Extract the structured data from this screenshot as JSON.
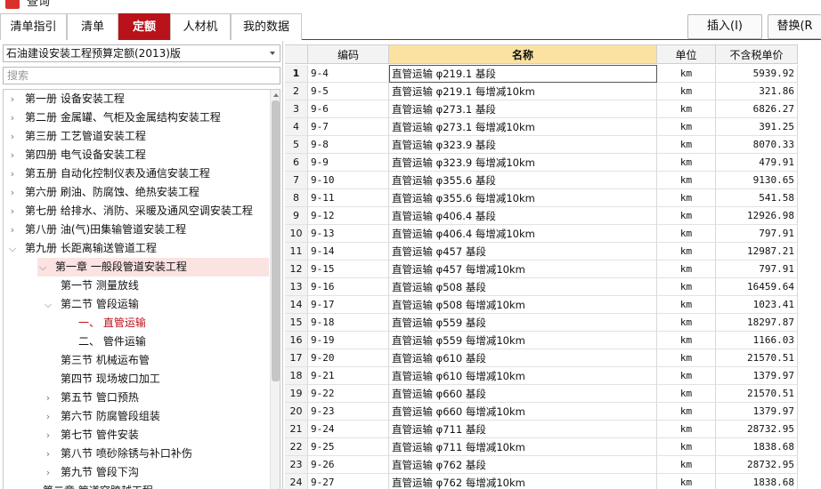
{
  "window": {
    "title": "查询"
  },
  "tabs": [
    {
      "label": "清单指引",
      "active": false
    },
    {
      "label": "清单",
      "active": false
    },
    {
      "label": "定额",
      "active": true
    },
    {
      "label": "人材机",
      "active": false
    },
    {
      "label": "我的数据",
      "active": false
    }
  ],
  "toolbar": {
    "insert_label": "插入(I)",
    "replace_label": "替换(R"
  },
  "library": {
    "selected": "石油建设安装工程预算定额(2013)版"
  },
  "search": {
    "placeholder": "搜索"
  },
  "tree": [
    {
      "label": "第一册  设备安装工程",
      "level": 0,
      "toggle": "›"
    },
    {
      "label": "第二册  金属罐、气柜及金属结构安装工程",
      "level": 0,
      "toggle": "›"
    },
    {
      "label": "第三册  工艺管道安装工程",
      "level": 0,
      "toggle": "›"
    },
    {
      "label": "第四册  电气设备安装工程",
      "level": 0,
      "toggle": "›"
    },
    {
      "label": "第五册  自动化控制仪表及通信安装工程",
      "level": 0,
      "toggle": "›"
    },
    {
      "label": "第六册  刷油、防腐蚀、绝热安装工程",
      "level": 0,
      "toggle": "›"
    },
    {
      "label": "第七册  给排水、消防、采暖及通风空调安装工程",
      "level": 0,
      "toggle": "›"
    },
    {
      "label": "第八册  油(气)田集输管道安装工程",
      "level": 0,
      "toggle": "›"
    },
    {
      "label": "第九册  长距离输送管道工程",
      "level": 0,
      "toggle": "⌄"
    },
    {
      "label": "第一章  一般段管道安装工程",
      "level": 1,
      "toggle": "⌄",
      "selected": true
    },
    {
      "label": "第一节  测量放线",
      "level": 2,
      "toggle": ""
    },
    {
      "label": "第二节  管段运输",
      "level": 2,
      "toggle": "⌄"
    },
    {
      "label": "一、  直管运输",
      "level": 3,
      "toggle": "",
      "active": true
    },
    {
      "label": "二、  管件运输",
      "level": 3,
      "toggle": ""
    },
    {
      "label": "第三节  机械运布管",
      "level": 2,
      "toggle": ""
    },
    {
      "label": "第四节  现场坡口加工",
      "level": 2,
      "toggle": ""
    },
    {
      "label": "第五节  管口预热",
      "level": 2,
      "toggle": "›"
    },
    {
      "label": "第六节  防腐管段组装",
      "level": 2,
      "toggle": "›"
    },
    {
      "label": "第七节  管件安装",
      "level": 2,
      "toggle": "›"
    },
    {
      "label": "第八节  喷砂除锈与补口补伤",
      "level": 2,
      "toggle": "›"
    },
    {
      "label": "第九节  管段下沟",
      "level": 2,
      "toggle": "›"
    },
    {
      "label": "第二章  管道穿跨越工程",
      "level": 1,
      "toggle": "›"
    }
  ],
  "table": {
    "columns": {
      "code": "编码",
      "name": "名称",
      "unit": "单位",
      "price": "不含税单价"
    },
    "rows": [
      {
        "no": "1",
        "code": "9-4",
        "name": "直管运输 φ219.1 基段",
        "unit": "km",
        "price": "5939.92"
      },
      {
        "no": "2",
        "code": "9-5",
        "name": "直管运输 φ219.1 每增减10km",
        "unit": "km",
        "price": "321.86"
      },
      {
        "no": "3",
        "code": "9-6",
        "name": "直管运输 φ273.1 基段",
        "unit": "km",
        "price": "6826.27"
      },
      {
        "no": "4",
        "code": "9-7",
        "name": "直管运输 φ273.1 每增减10km",
        "unit": "km",
        "price": "391.25"
      },
      {
        "no": "5",
        "code": "9-8",
        "name": "直管运输 φ323.9 基段",
        "unit": "km",
        "price": "8070.33"
      },
      {
        "no": "6",
        "code": "9-9",
        "name": "直管运输 φ323.9 每增减10km",
        "unit": "km",
        "price": "479.91"
      },
      {
        "no": "7",
        "code": "9-10",
        "name": "直管运输 φ355.6 基段",
        "unit": "km",
        "price": "9130.65"
      },
      {
        "no": "8",
        "code": "9-11",
        "name": "直管运输 φ355.6 每增减10km",
        "unit": "km",
        "price": "541.58"
      },
      {
        "no": "9",
        "code": "9-12",
        "name": "直管运输 φ406.4 基段",
        "unit": "km",
        "price": "12926.98"
      },
      {
        "no": "10",
        "code": "9-13",
        "name": "直管运输 φ406.4 每增减10km",
        "unit": "km",
        "price": "797.91"
      },
      {
        "no": "11",
        "code": "9-14",
        "name": "直管运输 φ457 基段",
        "unit": "km",
        "price": "12987.21"
      },
      {
        "no": "12",
        "code": "9-15",
        "name": "直管运输 φ457 每增减10km",
        "unit": "km",
        "price": "797.91"
      },
      {
        "no": "13",
        "code": "9-16",
        "name": "直管运输 φ508 基段",
        "unit": "km",
        "price": "16459.64"
      },
      {
        "no": "14",
        "code": "9-17",
        "name": "直管运输 φ508 每增减10km",
        "unit": "km",
        "price": "1023.41"
      },
      {
        "no": "15",
        "code": "9-18",
        "name": "直管运输 φ559 基段",
        "unit": "km",
        "price": "18297.87"
      },
      {
        "no": "16",
        "code": "9-19",
        "name": "直管运输 φ559 每增减10km",
        "unit": "km",
        "price": "1166.03"
      },
      {
        "no": "17",
        "code": "9-20",
        "name": "直管运输 φ610 基段",
        "unit": "km",
        "price": "21570.51"
      },
      {
        "no": "18",
        "code": "9-21",
        "name": "直管运输 φ610 每增减10km",
        "unit": "km",
        "price": "1379.97"
      },
      {
        "no": "19",
        "code": "9-22",
        "name": "直管运输 φ660 基段",
        "unit": "km",
        "price": "21570.51"
      },
      {
        "no": "20",
        "code": "9-23",
        "name": "直管运输 φ660 每增减10km",
        "unit": "km",
        "price": "1379.97"
      },
      {
        "no": "21",
        "code": "9-24",
        "name": "直管运输 φ711 基段",
        "unit": "km",
        "price": "28732.95"
      },
      {
        "no": "22",
        "code": "9-25",
        "name": "直管运输 φ711 每增减10km",
        "unit": "km",
        "price": "1838.68"
      },
      {
        "no": "23",
        "code": "9-26",
        "name": "直管运输 φ762 基段",
        "unit": "km",
        "price": "28732.95"
      },
      {
        "no": "24",
        "code": "9-27",
        "name": "直管运输 φ762 每增减10km",
        "unit": "km",
        "price": "1838.68"
      }
    ]
  }
}
